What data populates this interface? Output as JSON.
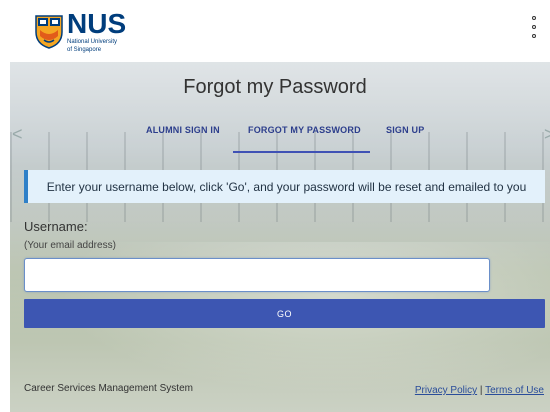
{
  "header": {
    "logo_text": "NUS",
    "logo_subtitle_line1": "National University",
    "logo_subtitle_line2": "of Singapore",
    "brand_color": "#003D7C"
  },
  "page": {
    "title": "Forgot my Password"
  },
  "tabs": [
    {
      "label": "ALUMNI SIGN IN",
      "active": false
    },
    {
      "label": "FORGOT MY PASSWORD",
      "active": true
    },
    {
      "label": "SIGN UP",
      "active": false
    }
  ],
  "nav": {
    "prev_arrow": "<",
    "next_arrow": ">"
  },
  "form": {
    "info_text": "Enter your username below, click 'Go', and your password will be reset and emailed to you",
    "username_label": "Username:",
    "username_hint": "(Your email address)",
    "username_value": "",
    "go_label": "GO",
    "button_color": "#3d56b2"
  },
  "footer": {
    "system_name": "Career Services Management System",
    "privacy_label": "Privacy Policy",
    "separator": " | ",
    "terms_label": "Terms of Use"
  },
  "icons": [
    "nus-crest-icon",
    "more-vertical-icon",
    "chevron-left-icon",
    "chevron-right-icon"
  ]
}
